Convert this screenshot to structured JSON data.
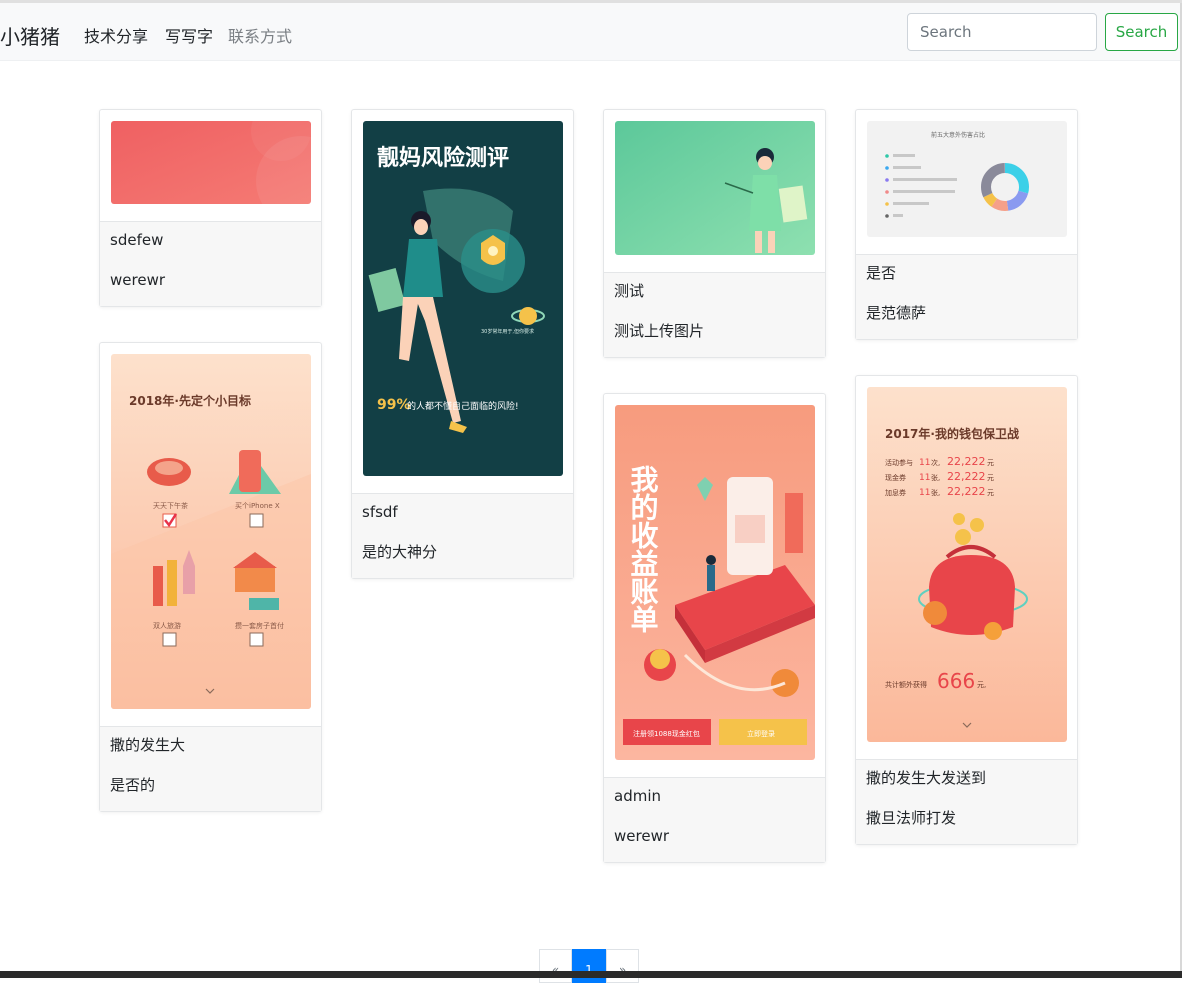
{
  "navbar": {
    "brand": "小猪猪",
    "links": [
      "技术分享",
      "写写字",
      "联系方式"
    ],
    "search_placeholder": "Search",
    "search_button": "Search"
  },
  "cards": [
    {
      "title": "sdefew",
      "desc": "werewr",
      "image": "red-gradient"
    },
    {
      "title": "撒的发生大",
      "desc": "是否的",
      "image": "2018-goals-poster"
    },
    {
      "title": "sfsdf",
      "desc": "是的大神分",
      "image": "risk-assessment-poster"
    },
    {
      "title": "测试",
      "desc": "测试上传图片",
      "image": "teacher-green-banner"
    },
    {
      "title": "admin",
      "desc": "werewr",
      "image": "earnings-bill-poster"
    },
    {
      "title": "是否",
      "desc": "是范德萨",
      "image": "donut-chart-thumbnail"
    },
    {
      "title": "撒的发生大发送到",
      "desc": "撒旦法师打发",
      "image": "2017-wallet-poster"
    }
  ],
  "images": {
    "poster_2018": {
      "heading": "2018年·先定个小目标",
      "label1": "天天下午茶",
      "label2": "买个iPhone X",
      "label3": "双人旅游",
      "label4": "攒一套房子首付"
    },
    "poster_risk": {
      "heading": "靓妈风险测评",
      "line1": "99%",
      "line2": "的人都不懂自己面临的风险!"
    },
    "poster_bill": {
      "heading": "我的收益账单",
      "btn1": "注册领1088现金红包",
      "btn2": "立即登录"
    },
    "poster_2017": {
      "heading": "2017年·我的钱包保卫战",
      "r1a": "活动参与",
      "r1b": "11",
      "r1c": "次,",
      "r1d": "22,222",
      "r1e": "元",
      "r2a": "现金券",
      "r2b": "11",
      "r2c": "张,",
      "r2d": "22,222",
      "r2e": "元",
      "r3a": "加息券",
      "r3b": "11",
      "r3c": "张,",
      "r3d": "22,222",
      "r3e": "元",
      "total_label": "共计额外获得",
      "total_value": "666",
      "total_unit": "元,"
    },
    "donut": {
      "heading": "前五大意外伤害占比"
    }
  },
  "pagination": {
    "prev": "«",
    "current": "1",
    "next": "»"
  },
  "colors": {
    "primary": "#007bff",
    "success": "#28a745",
    "navbar_bg": "#f8f9fa"
  }
}
